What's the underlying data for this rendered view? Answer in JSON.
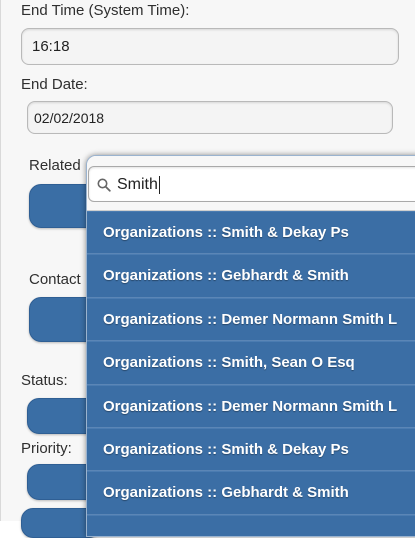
{
  "form": {
    "end_time_label": "End Time (System Time):",
    "end_time_value": "16:18",
    "end_date_label": "End Date:",
    "end_date_value": "02/02/2018",
    "related_label": "Related",
    "contact_label": "Contact",
    "status_label": "Status:",
    "priority_label": "Priority:"
  },
  "dropdown": {
    "search_value": "Smith",
    "search_icon": "search-icon",
    "options": [
      "Organizations :: Smith & Dekay Ps",
      "Organizations :: Gebhardt & Smith",
      "Organizations :: Demer Normann Smith L",
      "Organizations :: Smith, Sean O Esq",
      "Organizations :: Demer Normann Smith L",
      "Organizations :: Smith & Dekay Ps",
      "Organizations :: Gebhardt & Smith"
    ]
  },
  "colors": {
    "accent": "#3b6ea5",
    "panel_bg": "#f7f7f7"
  }
}
